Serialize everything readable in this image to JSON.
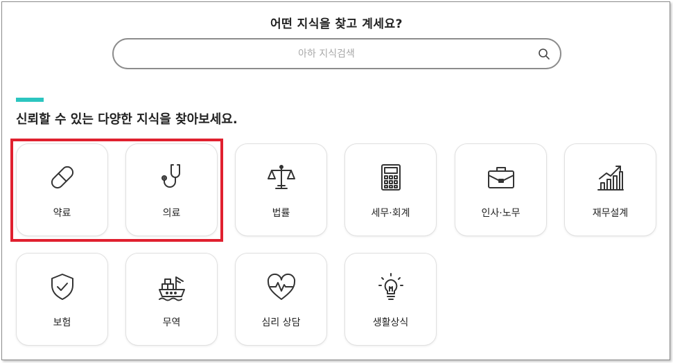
{
  "header": {
    "question": "어떤 지식을 찾고 계세요?"
  },
  "search": {
    "placeholder": "아하 지식검색",
    "value": ""
  },
  "section": {
    "title": "신뢰할 수 있는 다양한 지식을 찾아보세요."
  },
  "colors": {
    "accent": "#2cc5c0",
    "highlight": "#e0202f",
    "icon": "#333333"
  },
  "categories": [
    {
      "label": "약료",
      "icon": "pill-icon"
    },
    {
      "label": "의료",
      "icon": "stethoscope-icon"
    },
    {
      "label": "법률",
      "icon": "scales-icon"
    },
    {
      "label": "세무·회계",
      "icon": "calculator-icon"
    },
    {
      "label": "인사·노무",
      "icon": "briefcase-icon"
    },
    {
      "label": "재무설계",
      "icon": "growth-chart-icon"
    },
    {
      "label": "보험",
      "icon": "shield-check-icon"
    },
    {
      "label": "무역",
      "icon": "cargo-ship-icon"
    },
    {
      "label": "심리 상담",
      "icon": "heartbeat-icon"
    },
    {
      "label": "생활상식",
      "icon": "lightbulb-icon"
    }
  ]
}
